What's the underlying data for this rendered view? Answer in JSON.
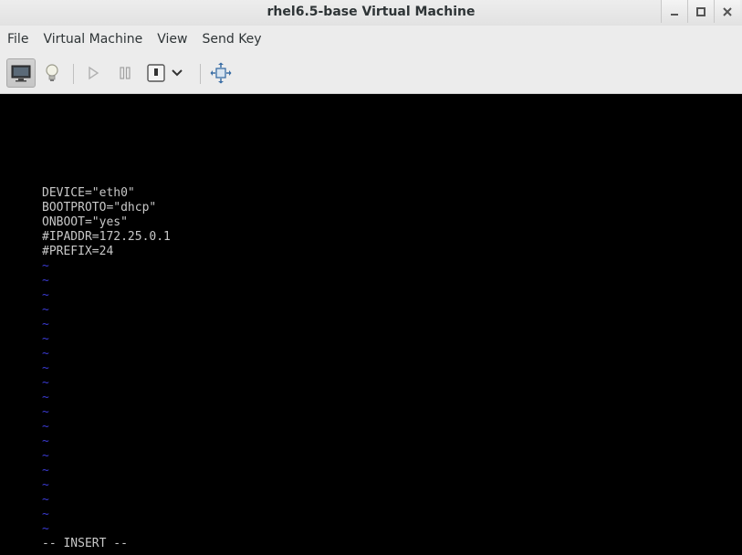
{
  "window": {
    "title": "rhel6.5-base Virtual Machine"
  },
  "menu": [
    "File",
    "Virtual Machine",
    "View",
    "Send Key"
  ],
  "toolbar": {
    "icons": [
      "console-icon",
      "details-lightbulb-icon",
      "run-icon",
      "pause-icon",
      "shutdown-icon",
      "dropdown-chevron-icon",
      "fullscreen-icon"
    ]
  },
  "editor": {
    "lines": [
      "DEVICE=\"eth0\"",
      "BOOTPROTO=\"dhcp\"",
      "ONBOOT=\"yes\"",
      "#IPADDR=172.25.0.1",
      "#PREFIX=24"
    ],
    "tilde": "~",
    "mode": "-- INSERT --",
    "colors": {
      "text": "#c8c8c8",
      "tilde": "#3a3ad0",
      "background": "#000000"
    }
  }
}
